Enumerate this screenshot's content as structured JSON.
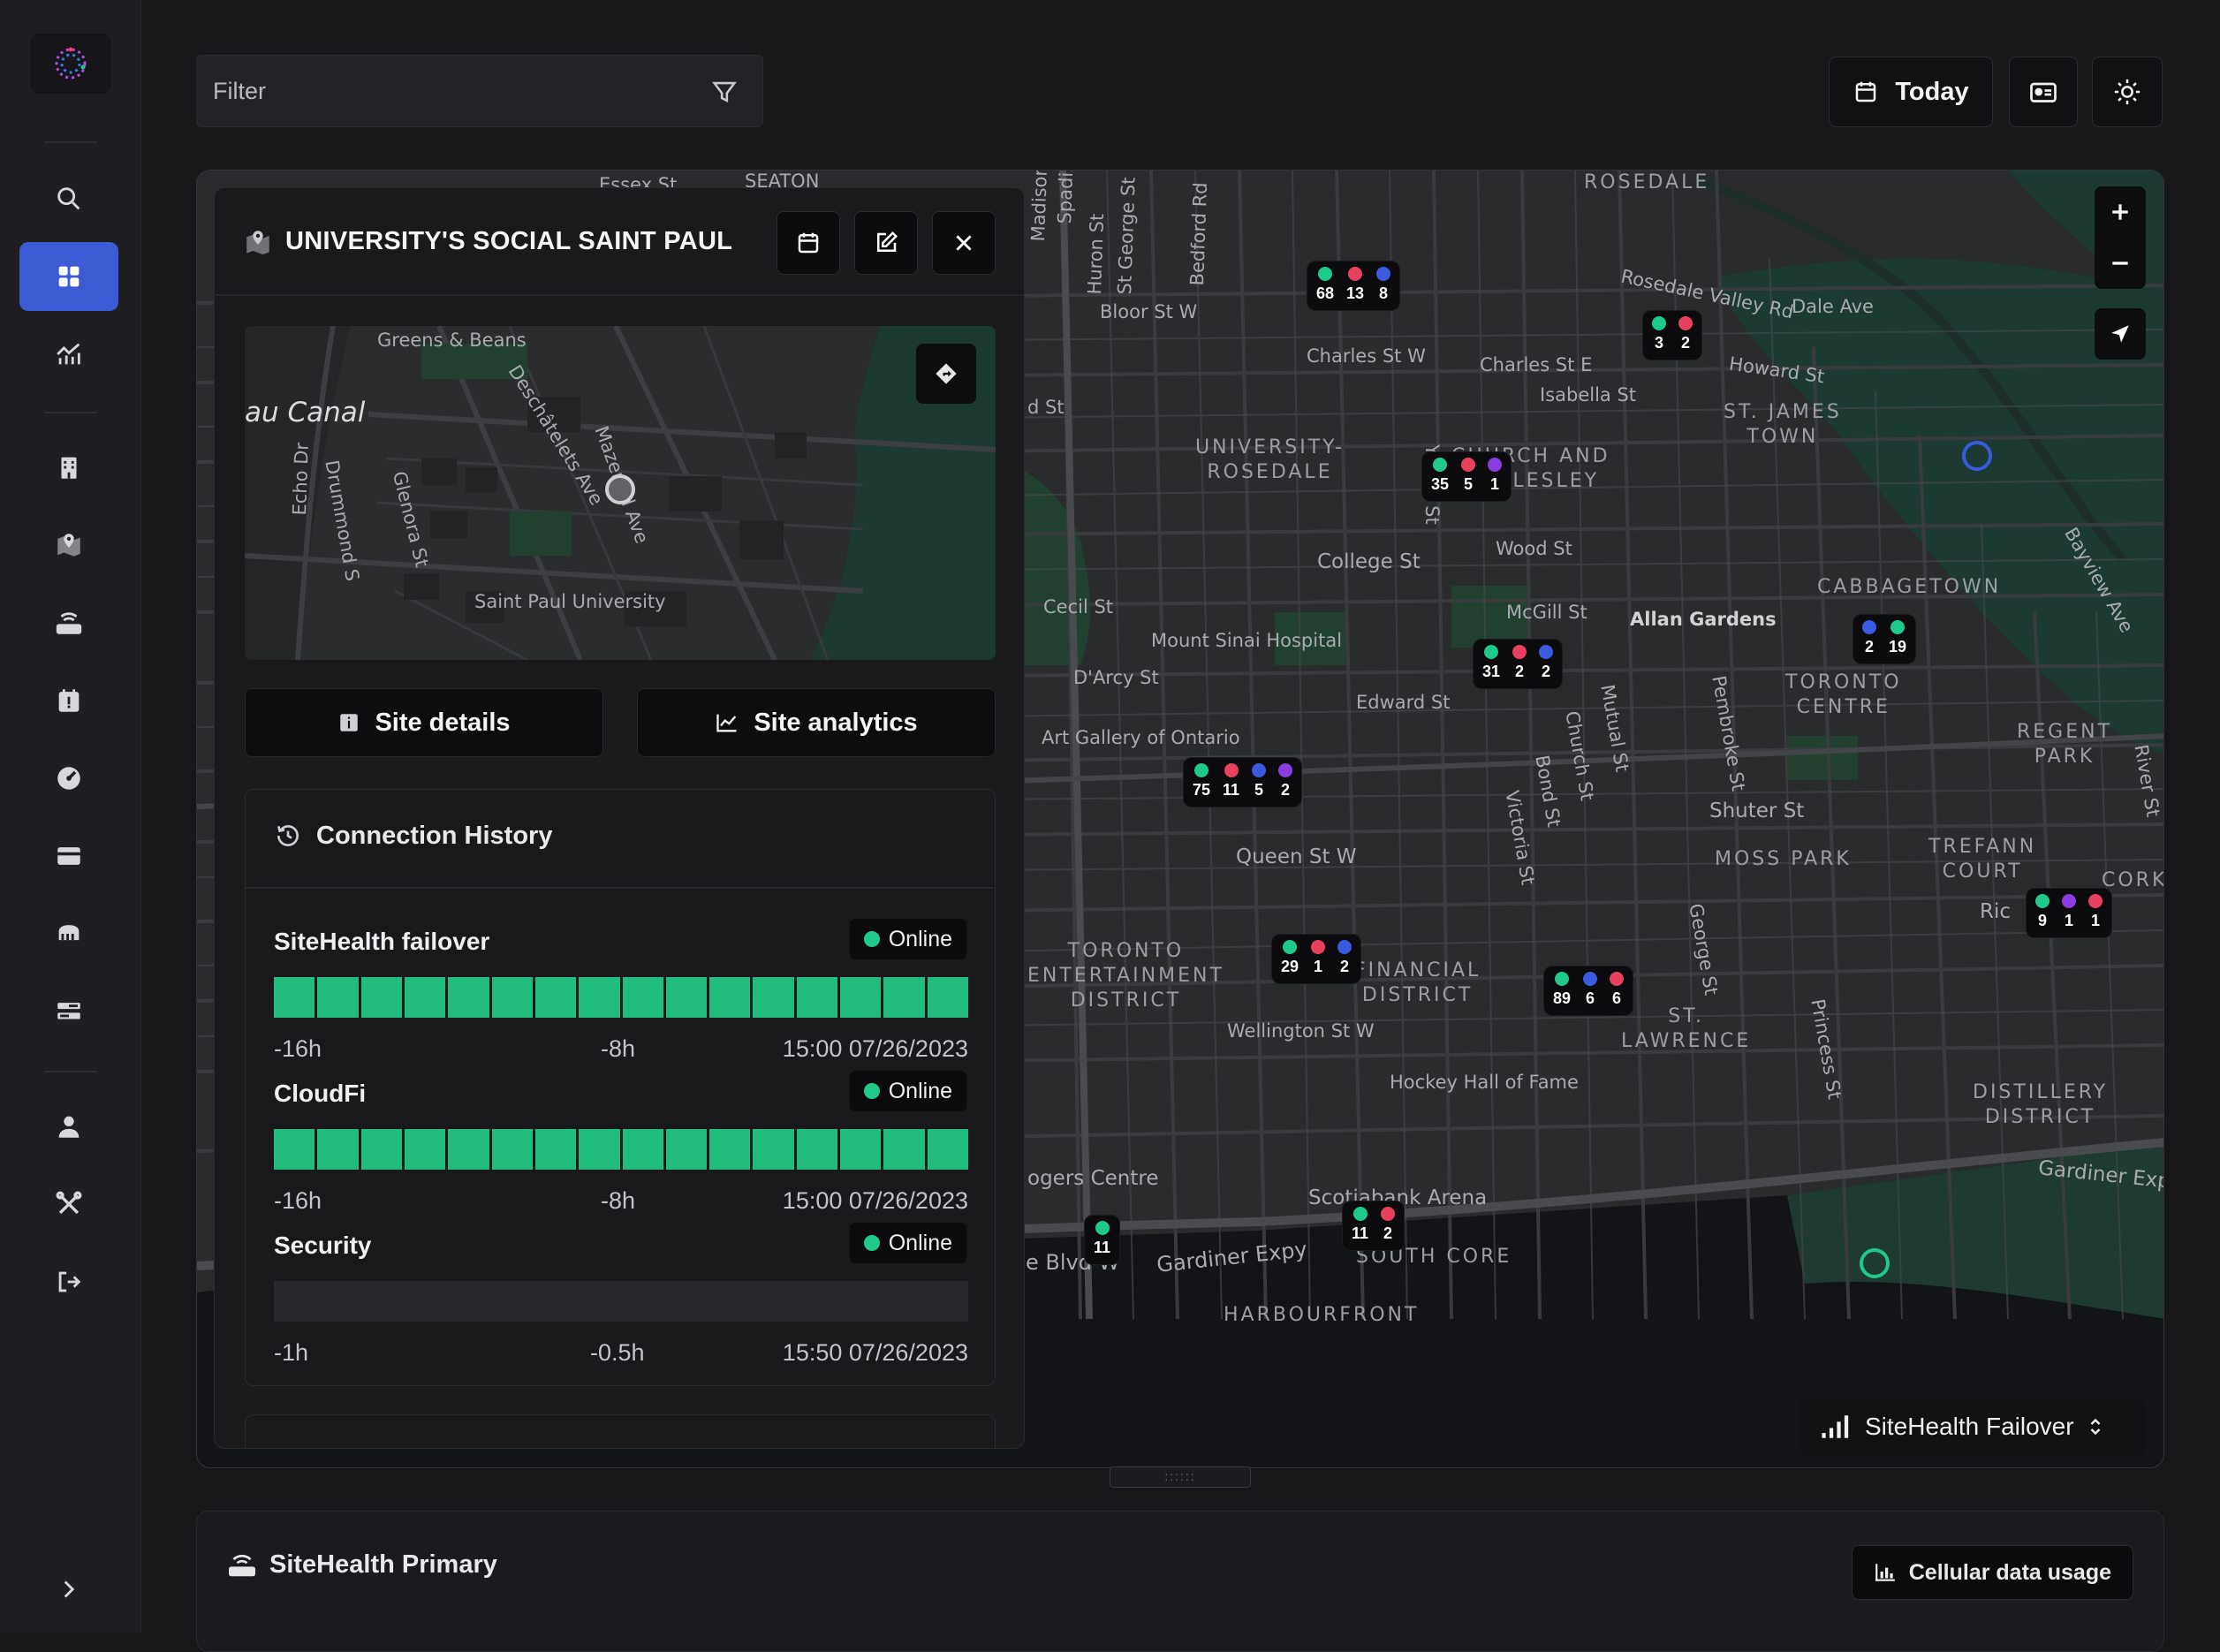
{
  "app": {
    "accent": "#3e5bd6",
    "online_color": "#22bd7e"
  },
  "sidebar": {
    "logo_icon": "logo-icon",
    "items": [
      {
        "icon": "search-icon"
      },
      {
        "icon": "dashboard-icon",
        "active": true
      },
      {
        "icon": "analytics-icon"
      },
      {
        "icon": "building-icon"
      },
      {
        "icon": "map-pin-icon"
      },
      {
        "icon": "router-icon"
      },
      {
        "icon": "calendar-alert-icon"
      },
      {
        "icon": "gauge-icon"
      },
      {
        "icon": "card-icon"
      },
      {
        "icon": "bus-icon"
      },
      {
        "icon": "server-icon"
      },
      {
        "icon": "user-icon"
      },
      {
        "icon": "tools-icon"
      },
      {
        "icon": "logout-icon"
      },
      {
        "icon": "chevron-right-icon"
      }
    ]
  },
  "topbar": {
    "filter_placeholder": "Filter",
    "today_label": "Today"
  },
  "panel": {
    "title": "UNIVERSITY'S SOCIAL SAINT PAUL",
    "minimap_labels": {
      "greens": "Greens & Beans",
      "canal": "au Canal",
      "deschatelets": "Deschâtelets Ave",
      "mazenod": "Mazenod Ave",
      "echo": "Echo Dr",
      "drummond": "Drummond S",
      "glenora": "Glenora St",
      "spu": "Saint Paul University"
    },
    "tabs": {
      "details": "Site details",
      "analytics": "Site analytics"
    },
    "connection": {
      "title": "Connection History",
      "services": [
        {
          "name": "SiteHealth failover",
          "status": "Online",
          "segments": 16,
          "axis": [
            "-16h",
            "-8h",
            "15:00 07/26/2023"
          ]
        },
        {
          "name": "CloudFi",
          "status": "Online",
          "segments": 16,
          "axis": [
            "-16h",
            "-8h",
            "15:00 07/26/2023"
          ]
        },
        {
          "name": "Security",
          "status": "Online",
          "segments": 0,
          "axis": [
            "-1h",
            "-0.5h",
            "15:50 07/26/2023"
          ]
        }
      ]
    }
  },
  "map": {
    "layer_selector": "SiteHealth Failover",
    "labels": {
      "rosedale": "ROSEDALE",
      "seaton": "SEATON",
      "essex": "Essex St",
      "spadina": "Spadina Rd",
      "madison": "Madison Ave",
      "huron": "Huron St",
      "stgeorge": "St George St",
      "bedford": "Bedford Rd",
      "bloor": "Bloor St W",
      "charles_w": "Charles St W",
      "charles_e": "Charles St E",
      "isabella": "Isabella St",
      "rosedale_valley": "Rosedale Valley Rd",
      "dale": "Dale Ave",
      "howard": "Howard St",
      "stjames": "ST. JAMES\nTOWN",
      "univ_rosedale": "UNIVERSITY-\nROSEDALE",
      "church_wellesley": "CHURCH AND\nWELLESLEY",
      "yonge": "Yonge St",
      "bayview": "Bayview Ave",
      "wood": "Wood St",
      "college": "College St",
      "cecil": "Cecil St",
      "mcgill": "McGill St",
      "allan": "Allan Gardens",
      "cabbagetown": "CABBAGETOWN",
      "mount_sinai": "Mount Sinai Hospital",
      "darcy": "D'Arcy St",
      "toronto_centre": "TORONTO\nCENTRE",
      "edward": "Edward St",
      "ago": "Art Gallery of Ontario",
      "regent": "REGENT\nPARK",
      "river": "River St",
      "pembroke": "Pembroke St",
      "mutual": "Mutual St",
      "church": "Church St",
      "bond": "Bond St",
      "victoria": "Victoria St",
      "shuter": "Shuter St",
      "queen": "Queen St W",
      "moss": "MOSS PARK",
      "trefann": "TREFANN\nCOURT",
      "cork": "CORK",
      "richmond": "Ric",
      "ent": "TORONTO\nENTERTAINMENT\nDISTRICT",
      "fin": "FINANCIAL\nDISTRICT",
      "george": "George St",
      "stlawrence": "ST.\nLAWRENCE",
      "princess": "Princess St",
      "wellington": "Wellington St W",
      "hockey": "Hockey Hall of Fame",
      "distillery": "DISTILLERY\nDISTRICT",
      "gardiner_e": "Gardiner Exp",
      "rogers": "ogers Centre",
      "scotiabank": "Scotiabank Arena",
      "south_core": "SOUTH CORE",
      "gardiner": "Gardiner Expy",
      "lakeshore": "e Blvd W",
      "harbourfront": "HARBOURFRONT",
      "dist_st": "d St"
    },
    "clusters": [
      {
        "counts": [
          {
            "c": "#1fc98a",
            "n": "68"
          },
          {
            "c": "#e8415f",
            "n": "13"
          },
          {
            "c": "#3a5be0",
            "n": "8"
          }
        ]
      },
      {
        "counts": [
          {
            "c": "#1fc98a",
            "n": "3"
          },
          {
            "c": "#e8415f",
            "n": "2"
          }
        ]
      },
      {
        "counts": [
          {
            "c": "#1fc98a",
            "n": "35"
          },
          {
            "c": "#e8415f",
            "n": "5"
          },
          {
            "c": "#8a3cde",
            "n": "1"
          }
        ]
      },
      {
        "counts": [
          {
            "c": "#3a5be0",
            "n": "2"
          },
          {
            "c": "#1fc98a",
            "n": "19"
          }
        ]
      },
      {
        "counts": [
          {
            "c": "#1fc98a",
            "n": "31"
          },
          {
            "c": "#e8415f",
            "n": "2"
          },
          {
            "c": "#3a5be0",
            "n": "2"
          }
        ]
      },
      {
        "counts": [
          {
            "c": "#1fc98a",
            "n": "75"
          },
          {
            "c": "#e8415f",
            "n": "11"
          },
          {
            "c": "#3a5be0",
            "n": "5"
          },
          {
            "c": "#8a3cde",
            "n": "2"
          }
        ]
      },
      {
        "counts": [
          {
            "c": "#1fc98a",
            "n": "29"
          },
          {
            "c": "#e8415f",
            "n": "1"
          },
          {
            "c": "#3a5be0",
            "n": "2"
          }
        ]
      },
      {
        "counts": [
          {
            "c": "#1fc98a",
            "n": "89"
          },
          {
            "c": "#3a5be0",
            "n": "6"
          },
          {
            "c": "#e8415f",
            "n": "6"
          }
        ]
      },
      {
        "counts": [
          {
            "c": "#1fc98a",
            "n": "9"
          },
          {
            "c": "#8a3cde",
            "n": "1"
          },
          {
            "c": "#e8415f",
            "n": "1"
          }
        ]
      },
      {
        "counts": [
          {
            "c": "#1fc98a",
            "n": "11"
          }
        ]
      },
      {
        "counts": [
          {
            "c": "#1fc98a",
            "n": "11"
          },
          {
            "c": "#e8415f",
            "n": "2"
          }
        ]
      }
    ]
  },
  "bottom": {
    "title": "SiteHealth Primary",
    "button": "Cellular data usage"
  }
}
